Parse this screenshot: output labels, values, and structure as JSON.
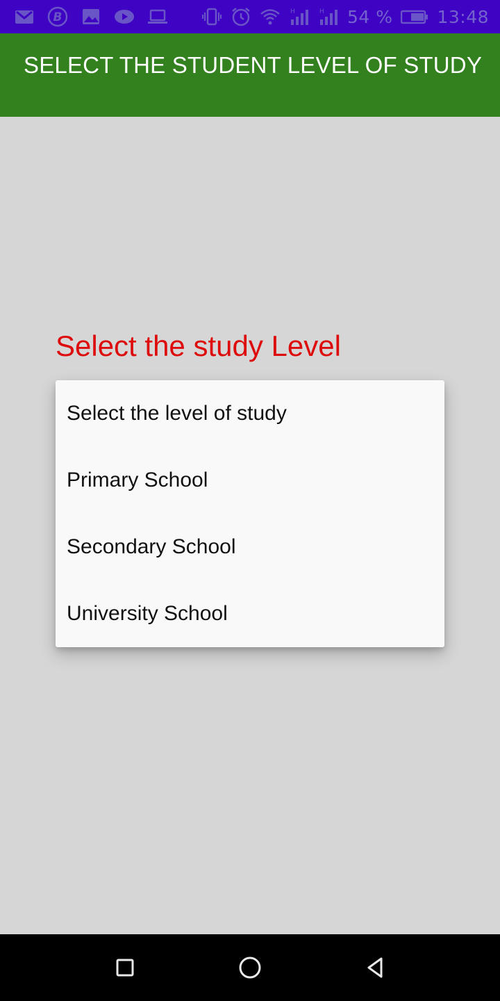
{
  "status_bar": {
    "battery_percent": "54 %",
    "time": "13:48",
    "left_icons": [
      "gmail-icon",
      "bitcoin-icon",
      "image-icon",
      "youtube-icon",
      "laptop-icon"
    ],
    "right_icons": [
      "vibrate-icon",
      "alarm-icon",
      "wifi-icon",
      "signal-icon",
      "signal-icon",
      "battery-icon"
    ],
    "colors": {
      "background": "#3f03c4",
      "icons": "#6a55c6"
    }
  },
  "app_bar": {
    "title": "SELECT THE STUDENT LEVEL OF STUDY",
    "color": "#33801f"
  },
  "main": {
    "label": "Select the study Level",
    "label_color": "#dd0b0b",
    "dropdown": {
      "items": [
        "Select the level of study",
        "Primary School",
        "Secondary School",
        "University School"
      ]
    }
  },
  "nav_bar": {
    "icons": [
      "recents-icon",
      "home-icon",
      "back-icon"
    ]
  }
}
